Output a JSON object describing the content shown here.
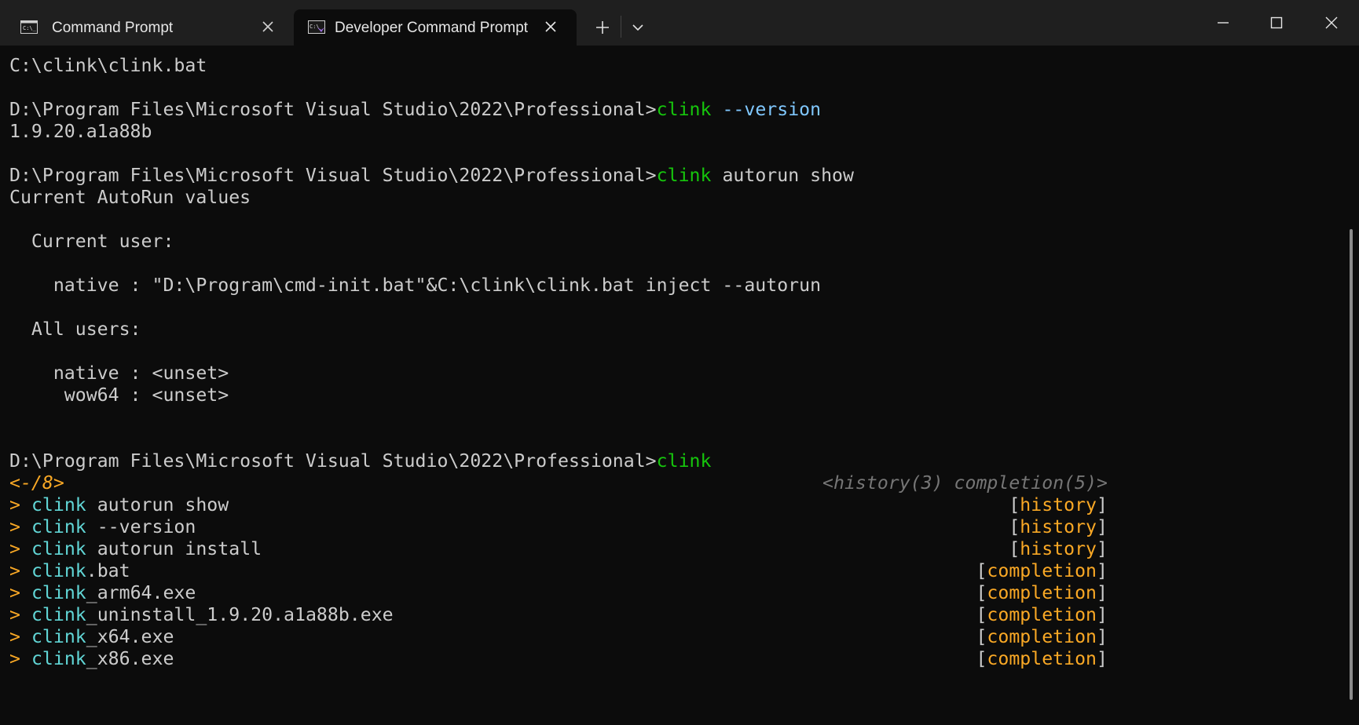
{
  "window": {
    "tabs": [
      {
        "label": "Command Prompt",
        "icon": "cmd-icon",
        "active": false
      },
      {
        "label": "Developer Command Prompt",
        "icon": "dev-cmd-icon",
        "active": true
      }
    ],
    "controls": {
      "new_tab": "plus-icon",
      "dropdown": "chevron-down-icon",
      "minimize": "minimize-icon",
      "maximize": "maximize-icon",
      "close": "close-icon"
    }
  },
  "colors": {
    "background": "#0c0c0c",
    "titlebar": "#1f1f1f",
    "text": "#cccccc",
    "command_green": "#16c60c",
    "match_cyan": "#61d6d6",
    "flag_blue": "#80c8ff",
    "marker_orange": "#f9a825",
    "hint_gray": "#767676"
  },
  "terminal": {
    "l1": "C:\\clink\\clink.bat",
    "prompt": "D:\\Program Files\\Microsoft Visual Studio\\2022\\Professional>",
    "cmd1": {
      "name": "clink",
      "arg": "--version"
    },
    "version_output": "1.9.20.a1a88b",
    "cmd2": {
      "name": "clink",
      "arg": "autorun show"
    },
    "autorun_header": "Current AutoRun values",
    "current_user_label": "  Current user:",
    "current_user_native": "    native : \"D:\\Program\\cmd-init.bat\"&C:\\clink\\clink.bat inject --autorun",
    "all_users_label": "  All users:",
    "all_users_native": "    native : <unset>",
    "all_users_wow64": "     wow64 : <unset>",
    "cmd3": {
      "name": "clink"
    },
    "popup_counter": "<-/8>",
    "popup_summary": "<history(3) completion(5)>",
    "marker": ">",
    "entries": [
      {
        "match": "clink",
        "rest": " autorun show",
        "open": "[",
        "source": "history",
        "close": "]"
      },
      {
        "match": "clink",
        "rest": " --version",
        "open": "[",
        "source": "history",
        "close": "]"
      },
      {
        "match": "clink",
        "rest": " autorun install",
        "open": "[",
        "source": "history",
        "close": "]"
      },
      {
        "match": "clink",
        "rest": ".bat",
        "open": "[",
        "source": "completion",
        "close": "]"
      },
      {
        "match": "clink",
        "rest": "_arm64.exe",
        "open": "[",
        "source": "completion",
        "close": "]"
      },
      {
        "match": "clink",
        "rest": "_uninstall_1.9.20.a1a88b.exe",
        "open": "[",
        "source": "completion",
        "close": "]"
      },
      {
        "match": "clink",
        "rest": "_x64.exe",
        "open": "[",
        "source": "completion",
        "close": "]"
      },
      {
        "match": "clink",
        "rest": "_x86.exe",
        "open": "[",
        "source": "completion",
        "close": "]"
      }
    ]
  }
}
